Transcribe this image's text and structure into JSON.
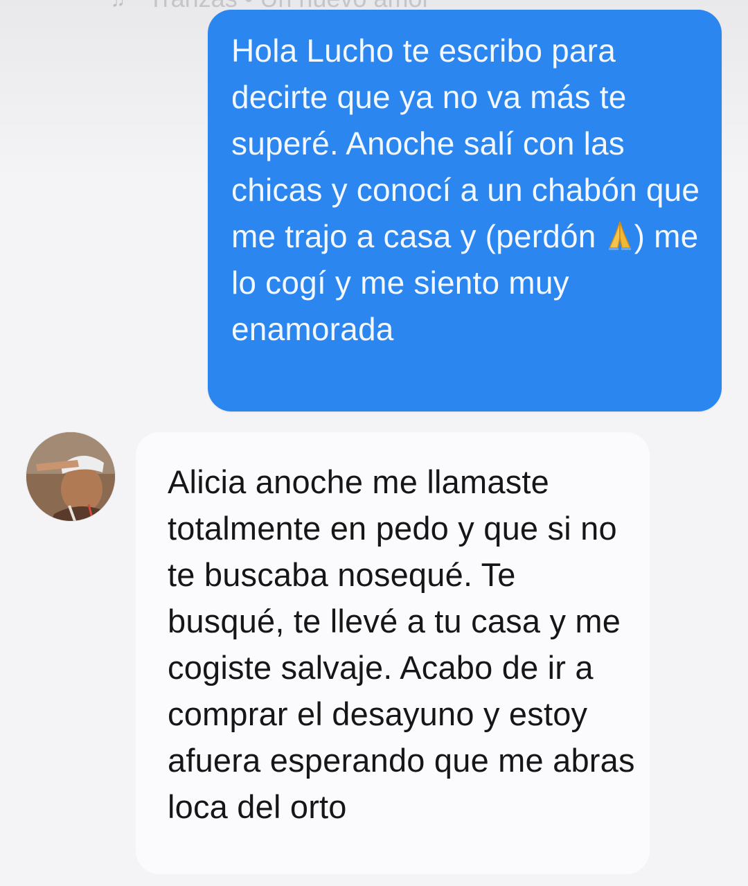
{
  "music_bar": {
    "note_icon": "music-note-icon",
    "text": "Tranzas • Un nuevo amor"
  },
  "conversation": {
    "sent_message": {
      "before_emoji": "Hola Lucho te escribo para decirte que ya no va más te superé. Anoche salí con las chicas y conocí a un chabón que me trajo a casa y (perdón",
      "emoji_icon": "folded-hands-icon",
      "after_emoji": ") me lo cogí y me siento muy enamorada"
    },
    "received_message": {
      "text": "Alicia anoche me llamaste totalmente en pedo y que si no te buscaba nosequé. Te busqué, te llevé a tu casa y me cogiste salvaje. Acabo de ir a comprar el desayuno y estoy afuera esperando que me abras loca del orto"
    },
    "avatar_icon": "contact-avatar-icon"
  },
  "colors": {
    "sent_bubble": "#2b86f0",
    "received_bubble": "#fbfbfd",
    "background": "#f4f4f6"
  }
}
